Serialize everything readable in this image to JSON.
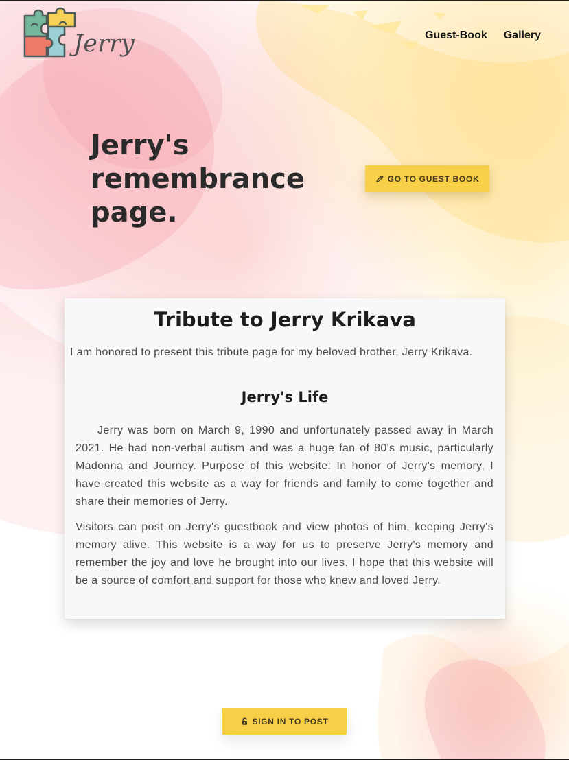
{
  "header": {
    "logo_text": "Jerry",
    "nav": [
      {
        "label": "Guest-Book"
      },
      {
        "label": "Gallery"
      }
    ]
  },
  "hero": {
    "title": "Jerry's remembrance page.",
    "cta": {
      "label": "GO TO GUEST BOOK",
      "icon": "pencil-icon"
    }
  },
  "tribute": {
    "title": "Tribute to Jerry Krikava",
    "intro": "I am honored to present this tribute page for my beloved brother, Jerry Krikava.",
    "section_title": "Jerry's Life",
    "paragraphs": [
      "Jerry was born on March 9, 1990 and unfortunately passed away in March 2021. He had non-verbal autism and was a huge fan of 80's music, particularly Madonna and Journey. Purpose of this website: In honor of Jerry's memory, I have created this website as a way for friends and family to come together and share their memories of Jerry.",
      "Visitors can post on Jerry's guestbook and view photos of him, keeping Jerry's memory alive. This website is a way for us to preserve Jerry's memory and remember the joy and love he brought into our lives. I hope that this website will be a source of comfort and support for those who knew and loved Jerry."
    ]
  },
  "footer_action": {
    "label": "SIGN IN TO POST",
    "icon": "lock-icon"
  },
  "colors": {
    "accent_yellow": "#f8cf49",
    "card_background": "#f8f8f8",
    "watercolor_pink": "#f59aa1",
    "watercolor_yellow": "#ffd674",
    "logo_teal": "#74b79c",
    "logo_blue": "#9bd0d5",
    "logo_coral": "#ef7b6b",
    "logo_gold": "#f6d158"
  }
}
